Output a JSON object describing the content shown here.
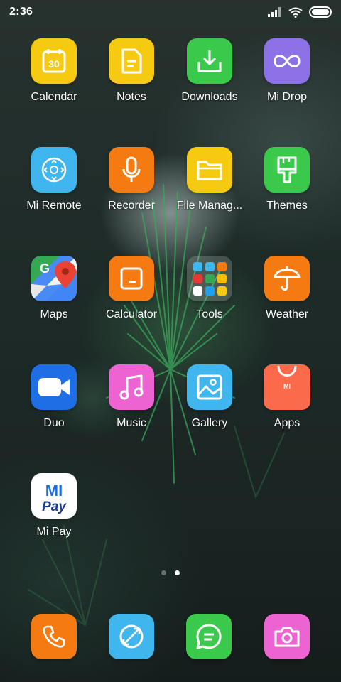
{
  "status_bar": {
    "time": "2:36"
  },
  "apps": [
    {
      "label": "Calendar",
      "icon": "calendar-icon",
      "color": "#F7CA12",
      "date": "30"
    },
    {
      "label": "Notes",
      "icon": "notes-icon",
      "color": "#F7CA12"
    },
    {
      "label": "Downloads",
      "icon": "download-icon",
      "color": "#3BC94B"
    },
    {
      "label": "Mi Drop",
      "icon": "infinity-icon",
      "color": "#8C72E6"
    },
    {
      "label": "Mi Remote",
      "icon": "remote-icon",
      "color": "#3FB6EE"
    },
    {
      "label": "Recorder",
      "icon": "microphone-icon",
      "color": "#F67A12"
    },
    {
      "label": "File Manag...",
      "icon": "folder-icon",
      "color": "#F7CA12"
    },
    {
      "label": "Themes",
      "icon": "paintbrush-icon",
      "color": "#3BC94B"
    },
    {
      "label": "Maps",
      "icon": "google-maps-icon",
      "color": "#FFFFFF"
    },
    {
      "label": "Calculator",
      "icon": "calculator-icon",
      "color": "#F67A12"
    },
    {
      "label": "Tools",
      "icon": "folder-tools-icon",
      "color": "#FFFFFF"
    },
    {
      "label": "Weather",
      "icon": "umbrella-icon",
      "color": "#F67A12"
    },
    {
      "label": "Duo",
      "icon": "video-camera-icon",
      "color": "#1E6FE6"
    },
    {
      "label": "Music",
      "icon": "music-note-icon",
      "color": "#EE63D2"
    },
    {
      "label": "Gallery",
      "icon": "image-icon",
      "color": "#3FB6EE"
    },
    {
      "label": "Apps",
      "icon": "mi-store-bag-icon",
      "color": "#FB6B4B",
      "badge": "MI"
    },
    {
      "label": "Mi Pay",
      "icon": "mi-pay-icon",
      "color": "#FFFFFF",
      "logo_top": "MI",
      "logo_bottom": "Pay"
    }
  ],
  "dock": [
    {
      "icon": "phone-icon",
      "color": "#F67A12"
    },
    {
      "icon": "compass-browser-icon",
      "color": "#3FB6EE"
    },
    {
      "icon": "message-icon",
      "color": "#3BC94B"
    },
    {
      "icon": "camera-icon",
      "color": "#EE63D2"
    }
  ],
  "pages": {
    "count": 2,
    "active": 2
  }
}
